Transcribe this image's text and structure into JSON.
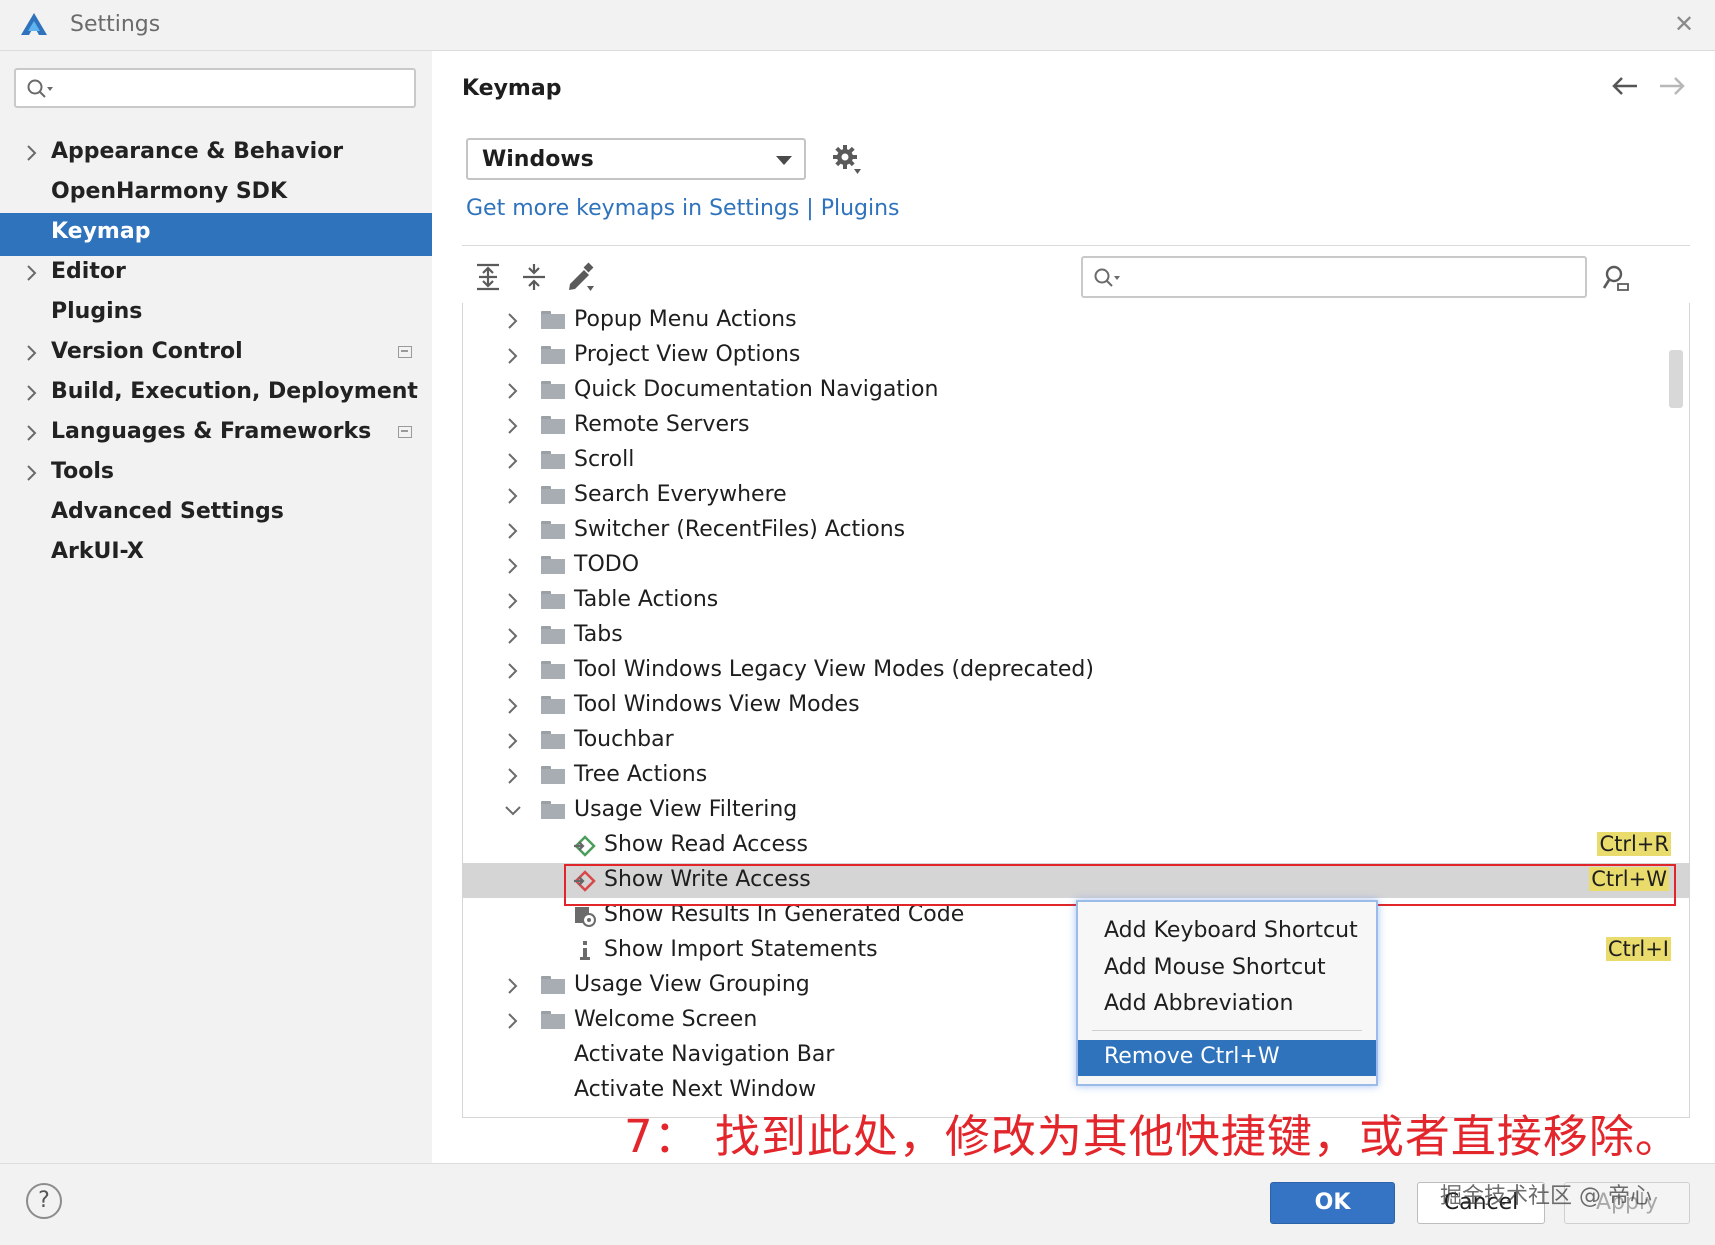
{
  "window": {
    "title": "Settings",
    "logo_icon": "deveco-studio-logo",
    "close_icon": "close-icon",
    "accent": "#2f73bc"
  },
  "sidebar": {
    "search_value": "",
    "items": [
      {
        "label": "Appearance & Behavior",
        "expandable": true,
        "modified": false
      },
      {
        "label": "OpenHarmony SDK",
        "expandable": false,
        "modified": false
      },
      {
        "label": "Keymap",
        "expandable": false,
        "modified": false,
        "selected": true
      },
      {
        "label": "Editor",
        "expandable": true,
        "modified": false
      },
      {
        "label": "Plugins",
        "expandable": false,
        "modified": false
      },
      {
        "label": "Version Control",
        "expandable": true,
        "modified": true
      },
      {
        "label": "Build, Execution, Deployment",
        "expandable": true,
        "modified": false
      },
      {
        "label": "Languages & Frameworks",
        "expandable": true,
        "modified": true
      },
      {
        "label": "Tools",
        "expandable": true,
        "modified": false
      },
      {
        "label": "Advanced Settings",
        "expandable": false,
        "modified": false
      },
      {
        "label": "ArkUI-X",
        "expandable": false,
        "modified": false
      }
    ]
  },
  "main": {
    "title": "Keymap",
    "keymap_select": "Windows",
    "plugins_link": "Get more keymaps in Settings | Plugins",
    "search_value": ""
  },
  "tree": {
    "rows": [
      {
        "label": "Popup Menu Actions",
        "type": "folder",
        "expanded": false
      },
      {
        "label": "Project View Options",
        "type": "folder",
        "expanded": false
      },
      {
        "label": "Quick Documentation Navigation",
        "type": "folder",
        "expanded": false
      },
      {
        "label": "Remote Servers",
        "type": "folder",
        "expanded": false
      },
      {
        "label": "Scroll",
        "type": "folder",
        "expanded": false
      },
      {
        "label": "Search Everywhere",
        "type": "folder",
        "expanded": false
      },
      {
        "label": "Switcher (RecentFiles) Actions",
        "type": "folder",
        "expanded": false
      },
      {
        "label": "TODO",
        "type": "folder",
        "expanded": false
      },
      {
        "label": "Table Actions",
        "type": "folder",
        "expanded": false
      },
      {
        "label": "Tabs",
        "type": "folder",
        "expanded": false
      },
      {
        "label": "Tool Windows Legacy View Modes (deprecated)",
        "type": "folder",
        "expanded": false
      },
      {
        "label": "Tool Windows View Modes",
        "type": "folder",
        "expanded": false
      },
      {
        "label": "Touchbar",
        "type": "folder",
        "expanded": false
      },
      {
        "label": "Tree Actions",
        "type": "folder",
        "expanded": false
      },
      {
        "label": "Usage View Filtering",
        "type": "folder",
        "expanded": true
      },
      {
        "label": "Show Read Access",
        "type": "action",
        "icon": "read-access-icon",
        "shortcut": "Ctrl+R"
      },
      {
        "label": "Show Write Access",
        "type": "action",
        "icon": "write-access-icon",
        "shortcut": "Ctrl+W",
        "selected": true
      },
      {
        "label": "Show Results In Generated Code",
        "type": "action",
        "icon": "generated-code-icon",
        "shortcut": ""
      },
      {
        "label": "Show Import Statements",
        "type": "action",
        "icon": "import-info-icon",
        "shortcut": "Ctrl+I"
      },
      {
        "label": "Usage View Grouping",
        "type": "folder",
        "expanded": false
      },
      {
        "label": "Welcome Screen",
        "type": "folder",
        "expanded": false
      },
      {
        "label": "Activate Navigation Bar",
        "type": "leaf"
      },
      {
        "label": "Activate Next Window",
        "type": "leaf"
      }
    ]
  },
  "context_menu": {
    "items": [
      {
        "label": "Add Keyboard Shortcut"
      },
      {
        "label": "Add Mouse Shortcut"
      },
      {
        "label": "Add Abbreviation"
      },
      {
        "label": "Remove Ctrl+W",
        "active": true
      }
    ]
  },
  "annotation": "7：  找到此处，修改为其他快捷键，或者直接移除。",
  "buttons": {
    "help": "?",
    "ok": "OK",
    "cancel": "Cancel",
    "apply": "Apply"
  },
  "watermark": "掘金技术社区 @ 帝心",
  "colors": {
    "selection": "#2f73bc",
    "highlight": "#e9dc6d",
    "annotation": "#e3262b"
  }
}
